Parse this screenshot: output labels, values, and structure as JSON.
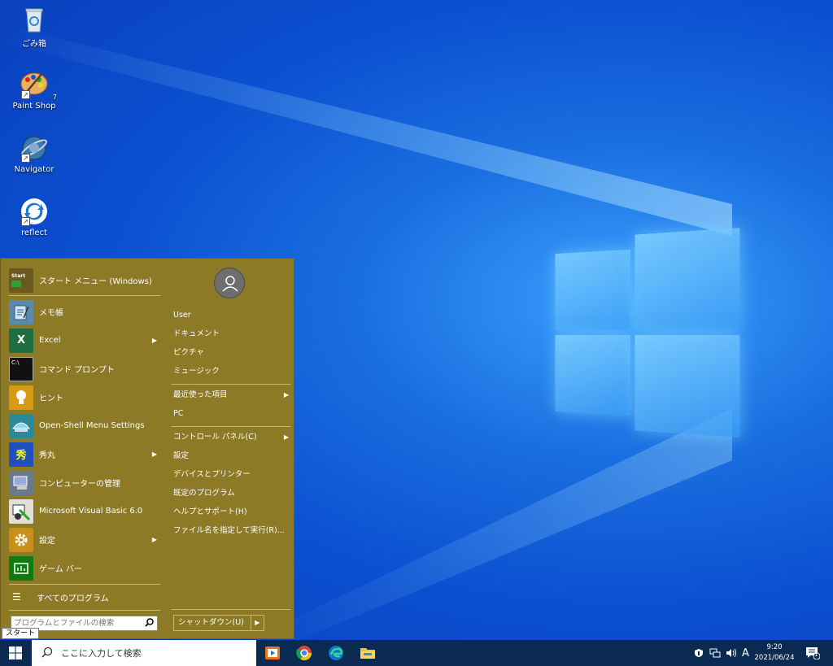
{
  "desktop": {
    "icons": [
      {
        "label": "ごみ箱",
        "icon": "recycle-bin-icon"
      },
      {
        "label": "Paint Shop",
        "icon": "paint-palette-icon",
        "badge": "7"
      },
      {
        "label": "Navigator",
        "icon": "navigator-globe-icon"
      },
      {
        "label": "reflect",
        "icon": "reflect-icon"
      }
    ]
  },
  "start_menu": {
    "programs": [
      {
        "label": "スタート メニュー (Windows)",
        "has_submenu": false,
        "icon_text": "Start"
      },
      {
        "label": "メモ帳",
        "has_submenu": false
      },
      {
        "label": "Excel",
        "has_submenu": true,
        "icon_text": "X"
      },
      {
        "label": "コマンド プロンプト",
        "has_submenu": false,
        "icon_text": "C:\\"
      },
      {
        "label": "ヒント",
        "has_submenu": false
      },
      {
        "label": "Open-Shell Menu Settings",
        "has_submenu": false
      },
      {
        "label": "秀丸",
        "has_submenu": true,
        "icon_text": "秀"
      },
      {
        "label": "コンピューターの管理",
        "has_submenu": false
      },
      {
        "label": "Microsoft Visual Basic 6.0",
        "has_submenu": false
      },
      {
        "label": "設定",
        "has_submenu": true
      },
      {
        "label": "ゲーム バー",
        "has_submenu": false
      }
    ],
    "all_programs": "すべてのプログラム",
    "search_placeholder": "プログラムとファイルの検索",
    "right_items": {
      "user": "User",
      "documents": "ドキュメント",
      "pictures": "ピクチャ",
      "music": "ミュージック",
      "recent": "最近使った項目",
      "pc": "PC",
      "control_panel": "コントロール パネル(C)",
      "settings": "設定",
      "devices": "デバイスとプリンター",
      "default_programs": "既定のプログラム",
      "help": "ヘルプとサポート(H)",
      "run": "ファイル名を指定して実行(R)..."
    },
    "shutdown_label": "シャットダウン(U)",
    "start_tooltip": "スタート"
  },
  "taskbar": {
    "search_placeholder": "ここに入力して検索",
    "apps": [
      "media-player-icon",
      "chrome-icon",
      "edge-icon",
      "file-explorer-icon"
    ],
    "ime": "A",
    "time": "9:20",
    "date": "2021/06/24",
    "notification_count": "1"
  }
}
